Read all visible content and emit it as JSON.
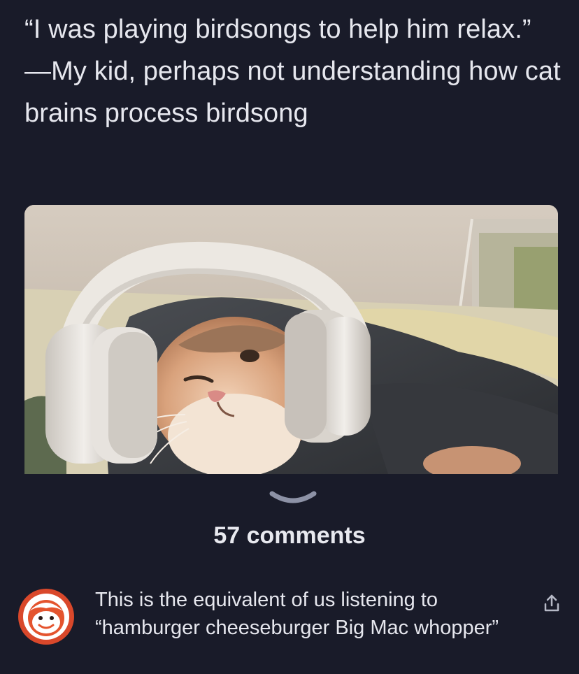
{
  "post": {
    "quote_text": "“I was playing birdsongs to help him relax.” —My kid, perhaps not understanding how cat brains process birdsong",
    "image": {
      "subject": "cat wearing white headphones lying under a blanket"
    },
    "expand_icon": "chevron-down-icon"
  },
  "comments": {
    "count_label": "57 comments"
  },
  "top_comment": {
    "avatar_icon": "smiley-avatar-icon",
    "text": "This is the equivalent of us listening to “hamburger cheeseburger Big Mac whopper”",
    "share_icon": "share-icon"
  },
  "colors": {
    "background": "#191b29",
    "text": "#e6e7ee",
    "avatar_ring": "#d9482b"
  }
}
